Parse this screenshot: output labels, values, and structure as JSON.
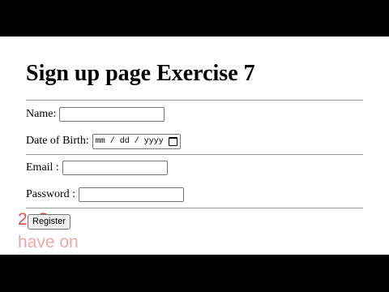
{
  "page": {
    "title": "Sign up page Exercise 7"
  },
  "form": {
    "name_label": "Name:",
    "name_value": "",
    "dob_label": "Date of Birth:",
    "dob_placeholder": "mm / dd / yyyy",
    "email_label": "Email :",
    "email_value": "",
    "password_label": "Password :",
    "password_value": "",
    "register_label": "Register"
  },
  "overlay": {
    "line1": "2. Cr",
    "line2": "have on"
  },
  "colors": {
    "page_background": "#ffffff",
    "letterbox": "#000000",
    "overlay_text": "#d93a3a"
  }
}
